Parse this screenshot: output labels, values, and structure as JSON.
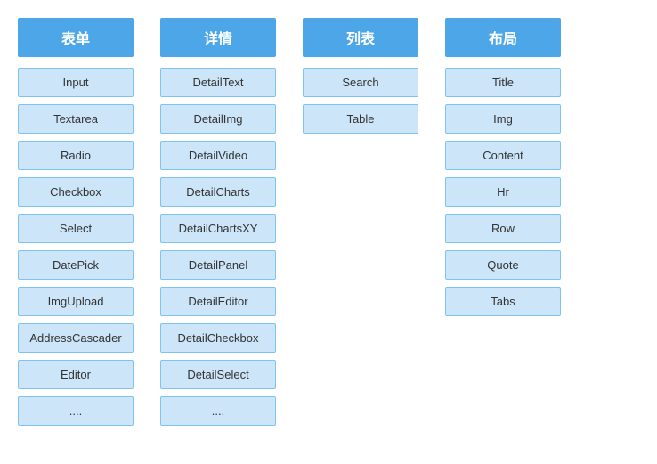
{
  "columns": [
    {
      "id": "form-column",
      "header": "表单",
      "items": [
        "Input",
        "Textarea",
        "Radio",
        "Checkbox",
        "Select",
        "DatePick",
        "ImgUpload",
        "AddressCascader",
        "Editor",
        "...."
      ]
    },
    {
      "id": "detail-column",
      "header": "详情",
      "items": [
        "DetailText",
        "DetailImg",
        "DetailVideo",
        "DetailCharts",
        "DetailChartsXY",
        "DetailPanel",
        "DetailEditor",
        "DetailCheckbox",
        "DetailSelect",
        "...."
      ]
    },
    {
      "id": "list-column",
      "header": "列表",
      "items": [
        "Search",
        "Table"
      ]
    },
    {
      "id": "layout-column",
      "header": "布局",
      "items": [
        "Title",
        "Img",
        "Content",
        "Hr",
        "Row",
        "Quote",
        "Tabs"
      ]
    }
  ]
}
